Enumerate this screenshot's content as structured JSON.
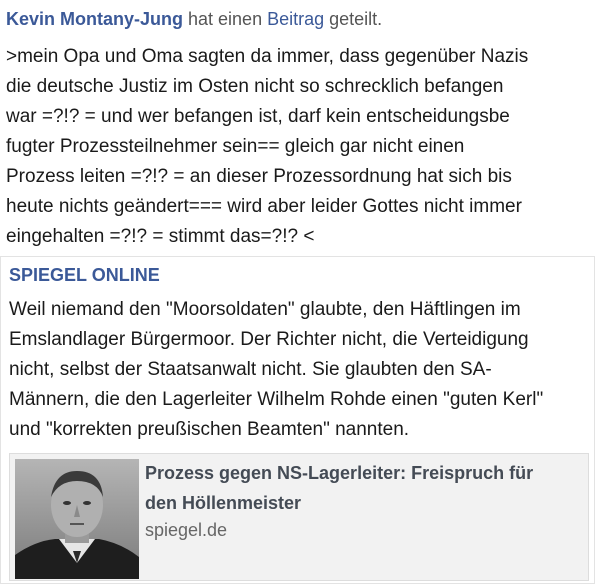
{
  "header": {
    "author": "Kevin Montany-Jung",
    "text_before": " hat einen ",
    "link_word": "Beitrag",
    "text_after": " geteilt."
  },
  "post": {
    "text": ">mein Opa und Oma sagten da immer, dass gegenüber Nazis\ndie deutsche Justiz im Osten nicht so schrecklich befangen\nwar =?!? = und wer befangen ist, darf kein entscheidungsbe\nfugter Prozessteilnehmer  sein== gleich gar nicht einen\nProzess leiten =?!? = an dieser Prozessordnung hat sich bis\nheute nichts geändert=== wird aber leider Gottes nicht immer\neingehalten =?!? = stimmt das=?!? <"
  },
  "shared": {
    "source": "SPIEGEL ONLINE",
    "text": "Weil  niemand den \"Moorsoldaten\" glaubte, den Häftlingen im\nEmslandlager Bürgermoor. Der Richter nicht, die Verteidigung\nnicht, selbst der Staatsanwalt nicht. Sie glaubten den SA-\nMännern, die den Lagerleiter Wilhelm  Rohde einen \"guten Kerl\"\nund \"korrekten preußischen Beamten\"  nannten.",
    "link": {
      "title": "Prozess gegen NS-Lagerleiter:  Freispruch für\nden Höllenmeister",
      "domain": "spiegel.de"
    }
  }
}
